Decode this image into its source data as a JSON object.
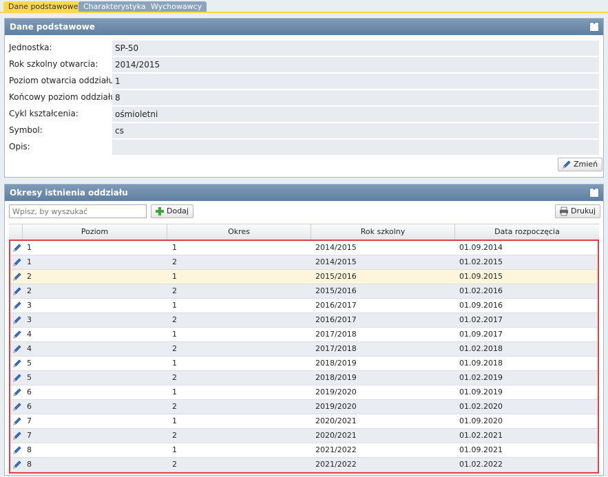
{
  "tabs": [
    "Dane podstawowe",
    "Charakterystyka",
    "Wychowawcy"
  ],
  "basic_panel": {
    "title": "Dane podstawowe",
    "fields": [
      {
        "label": "Jednostka:",
        "value": "SP-50"
      },
      {
        "label": "Rok szkolny otwarcia:",
        "value": "2014/2015"
      },
      {
        "label": "Poziom otwarcia oddziału:",
        "value": "1"
      },
      {
        "label": "Końcowy poziom oddziału:",
        "value": "8"
      },
      {
        "label": "Cykl kształcenia:",
        "value": "ośmioletni"
      },
      {
        "label": "Symbol:",
        "value": "cs"
      },
      {
        "label": "Opis:",
        "value": ""
      }
    ],
    "change_button": "Zmień"
  },
  "periods_panel": {
    "title": "Okresy istnienia oddziału",
    "search_placeholder": "Wpisz, by wyszukać",
    "add_button": "Dodaj",
    "print_button": "Drukuj",
    "columns": [
      "Poziom",
      "Okres",
      "Rok szkolny",
      "Data rozpoczęcia"
    ],
    "rows": [
      [
        "1",
        "1",
        "2014/2015",
        "01.09.2014"
      ],
      [
        "1",
        "2",
        "2014/2015",
        "01.02.2015"
      ],
      [
        "2",
        "1",
        "2015/2016",
        "01.09.2015"
      ],
      [
        "2",
        "2",
        "2015/2016",
        "01.02.2016"
      ],
      [
        "3",
        "1",
        "2016/2017",
        "01.09.2016"
      ],
      [
        "3",
        "2",
        "2016/2017",
        "01.02.2017"
      ],
      [
        "4",
        "1",
        "2017/2018",
        "01.09.2017"
      ],
      [
        "4",
        "2",
        "2017/2018",
        "01.02.2018"
      ],
      [
        "5",
        "1",
        "2018/2019",
        "01.09.2018"
      ],
      [
        "5",
        "2",
        "2018/2019",
        "01.02.2019"
      ],
      [
        "6",
        "1",
        "2019/2020",
        "01.09.2019"
      ],
      [
        "6",
        "2",
        "2019/2020",
        "01.02.2020"
      ],
      [
        "7",
        "1",
        "2020/2021",
        "01.09.2020"
      ],
      [
        "7",
        "2",
        "2020/2021",
        "01.02.2021"
      ],
      [
        "8",
        "1",
        "2021/2022",
        "01.09.2021"
      ],
      [
        "8",
        "2",
        "2021/2022",
        "01.02.2022"
      ]
    ],
    "highlighted_row": 2
  },
  "colors": {
    "active_tab": "#ffd94a",
    "panel_header": "#6f8eab",
    "selection_outline": "#e04048",
    "highlight_row": "#fdf6dc",
    "alt_row": "#e9edf1"
  }
}
